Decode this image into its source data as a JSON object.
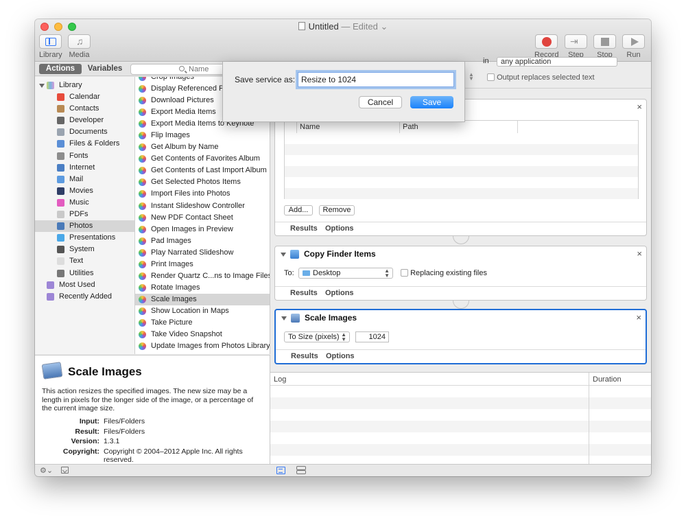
{
  "window": {
    "title": "Untitled",
    "status": "— Edited ⌄"
  },
  "toolbar": {
    "library": "Library",
    "media": "Media",
    "record": "Record",
    "step": "Step",
    "stop": "Stop",
    "run": "Run"
  },
  "tabs": {
    "actions": "Actions",
    "variables": "Variables"
  },
  "search": {
    "placeholder": "Name"
  },
  "library": {
    "root": "Library",
    "items": [
      {
        "label": "Calendar",
        "color": "#e74c3c"
      },
      {
        "label": "Contacts",
        "color": "#b88a54"
      },
      {
        "label": "Developer",
        "color": "#666666"
      },
      {
        "label": "Documents",
        "color": "#9aa4b0"
      },
      {
        "label": "Files & Folders",
        "color": "#5b8fd6"
      },
      {
        "label": "Fonts",
        "color": "#8d8d8d"
      },
      {
        "label": "Internet",
        "color": "#4b7fc4"
      },
      {
        "label": "Mail",
        "color": "#5d9be0"
      },
      {
        "label": "Movies",
        "color": "#2f3e66"
      },
      {
        "label": "Music",
        "color": "#e35cc0"
      },
      {
        "label": "PDFs",
        "color": "#c9c9c9"
      },
      {
        "label": "Photos",
        "color": "#4a7ab8"
      },
      {
        "label": "Presentations",
        "color": "#4aa8e8"
      },
      {
        "label": "System",
        "color": "#555555"
      },
      {
        "label": "Text",
        "color": "#dddddd"
      },
      {
        "label": "Utilities",
        "color": "#777777"
      }
    ],
    "smart": [
      {
        "label": "Most Used",
        "color": "#9d86d6"
      },
      {
        "label": "Recently Added",
        "color": "#9d86d6"
      }
    ]
  },
  "actions": [
    "Crop Images",
    "Display Referenced Ph",
    "Download Pictures",
    "Export Media Items",
    "Export Media Items to Keynote",
    "Flip Images",
    "Get Album by Name",
    "Get Contents of Favorites Album",
    "Get Contents of Last Import Album",
    "Get Selected Photos Items",
    "Import Files into Photos",
    "Instant Slideshow Controller",
    "New PDF Contact Sheet",
    "Open Images in Preview",
    "Pad Images",
    "Play Narrated Slideshow",
    "Print Images",
    "Render Quartz C...ns to Image Files",
    "Rotate Images",
    "Scale Images",
    "Show Location in Maps",
    "Take Picture",
    "Take Video Snapshot",
    "Update Images from Photos Library"
  ],
  "description": {
    "title": "Scale Images",
    "text": "This action resizes the specified images. The new size may be a length in pixels for the longer side of the image, or a percentage of the current image size.",
    "input_k": "Input:",
    "input_v": "Files/Folders",
    "result_k": "Result:",
    "result_v": "Files/Folders",
    "version_k": "Version:",
    "version_v": "1.3.1",
    "copyright_k": "Copyright:",
    "copyright_v": "Copyright © 2004–2012 Apple Inc.  All rights reserved."
  },
  "service_opts": {
    "in_label": "in",
    "application": "any application",
    "output_replaces": "Output replaces selected text"
  },
  "card1": {
    "col_name": "Name",
    "col_path": "Path",
    "add": "Add...",
    "remove": "Remove",
    "results": "Results",
    "options": "Options"
  },
  "card2": {
    "title": "Copy Finder Items",
    "to_label": "To:",
    "to_value": "Desktop",
    "replacing": "Replacing existing files",
    "results": "Results",
    "options": "Options"
  },
  "card3": {
    "title": "Scale Images",
    "mode": "To Size (pixels)",
    "size": "1024",
    "results": "Results",
    "options": "Options"
  },
  "log": {
    "col_log": "Log",
    "col_duration": "Duration"
  },
  "sheet": {
    "label": "Save service as:",
    "value": "Resize to 1024",
    "cancel": "Cancel",
    "save": "Save"
  },
  "close_glyph": "×"
}
